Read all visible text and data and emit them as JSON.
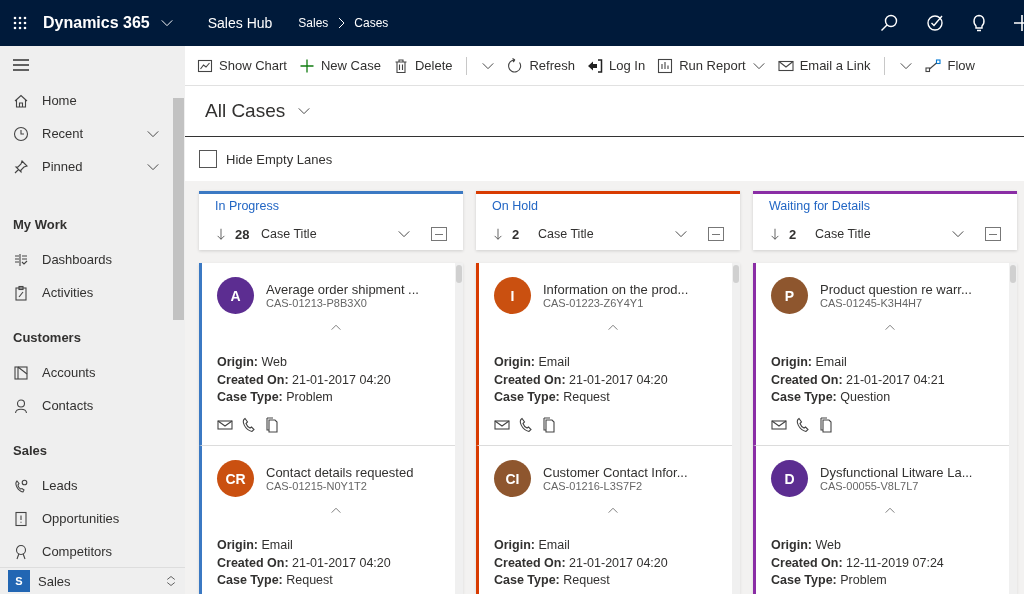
{
  "top_bar": {
    "app_name": "Dynamics 365",
    "hub": "Sales Hub",
    "breadcrumb": [
      "Sales",
      "Cases"
    ]
  },
  "sidebar": {
    "items": [
      {
        "label": "Home",
        "kind": "link"
      },
      {
        "label": "Recent",
        "kind": "expandable"
      },
      {
        "label": "Pinned",
        "kind": "expandable"
      }
    ],
    "groups": [
      {
        "title": "My Work",
        "items": [
          {
            "label": "Dashboards",
            "kind": "link"
          },
          {
            "label": "Activities",
            "kind": "link"
          }
        ]
      },
      {
        "title": "Customers",
        "items": [
          {
            "label": "Accounts",
            "kind": "link"
          },
          {
            "label": "Contacts",
            "kind": "link"
          }
        ]
      },
      {
        "title": "Sales",
        "items": [
          {
            "label": "Leads",
            "kind": "link"
          },
          {
            "label": "Opportunities",
            "kind": "link"
          },
          {
            "label": "Competitors",
            "kind": "link"
          }
        ]
      }
    ],
    "area": {
      "initial": "S",
      "label": "Sales"
    }
  },
  "command_bar": [
    {
      "label": "Show Chart",
      "kind": "button"
    },
    {
      "label": "New Case",
      "kind": "button"
    },
    {
      "label": "Delete",
      "kind": "split"
    },
    {
      "label": "Refresh",
      "kind": "button"
    },
    {
      "label": "Log In",
      "kind": "button"
    },
    {
      "label": "Run Report",
      "kind": "menu"
    },
    {
      "label": "Email a Link",
      "kind": "split"
    },
    {
      "label": "Flow",
      "kind": "button"
    }
  ],
  "view": {
    "title": "All Cases"
  },
  "hide_empty_lanes": {
    "label": "Hide Empty Lanes",
    "checked": false
  },
  "lanes": [
    {
      "title": "In Progress",
      "color": "#3b79c3",
      "count": "28",
      "sort_field": "Case Title",
      "cards": [
        {
          "initials": "A",
          "color": "#5c2d91",
          "title": "Average order shipment ...",
          "case_number": "CAS-01213-P8B3X0",
          "actions": true,
          "fields": [
            "**Origin:** Web",
            "**Created On:** 21-01-2017 04:20",
            "**Case Type:** Problem"
          ]
        },
        {
          "initials": "CR",
          "color": "#ca5010",
          "title": "Contact details requested",
          "case_number": "CAS-01215-N0Y1T2",
          "fields": [
            "**Origin:** Email",
            "**Created On:** 21-01-2017 04:20",
            "**Case Type:** Request"
          ]
        }
      ]
    },
    {
      "title": "On Hold",
      "color": "#d83b01",
      "count": "2",
      "sort_field": "Case Title",
      "cards": [
        {
          "initials": "I",
          "color": "#ca5010",
          "title": "Information on the prod...",
          "case_number": "CAS-01223-Z6Y4Y1",
          "actions": true,
          "fields": [
            "**Origin:** Email",
            "**Created On:** 21-01-2017 04:20",
            "**Case Type:** Request"
          ]
        },
        {
          "initials": "CI",
          "color": "#8e562e",
          "title": "Customer Contact Infor...",
          "case_number": "CAS-01216-L3S7F2",
          "fields": [
            "**Origin:** Email",
            "**Created On:** 21-01-2017 04:20",
            "**Case Type:** Request"
          ]
        }
      ]
    },
    {
      "title": "Waiting for Details",
      "color": "#8a2da5",
      "count": "2",
      "sort_field": "Case Title",
      "cards": [
        {
          "initials": "P",
          "color": "#8e562e",
          "title": "Product question re warr...",
          "case_number": "CAS-01245-K3H4H7",
          "actions": true,
          "fields": [
            "**Origin:** Email",
            "**Created On:** 21-01-2017 04:21",
            "**Case Type:** Question"
          ]
        },
        {
          "initials": "D",
          "color": "#5c2d91",
          "title": "Dysfunctional Litware La...",
          "case_number": "CAS-00055-V8L7L7",
          "fields": [
            "**Origin:** Web",
            "**Created On:** 12-11-2019 07:24",
            "**Case Type:** Problem"
          ]
        }
      ]
    }
  ]
}
